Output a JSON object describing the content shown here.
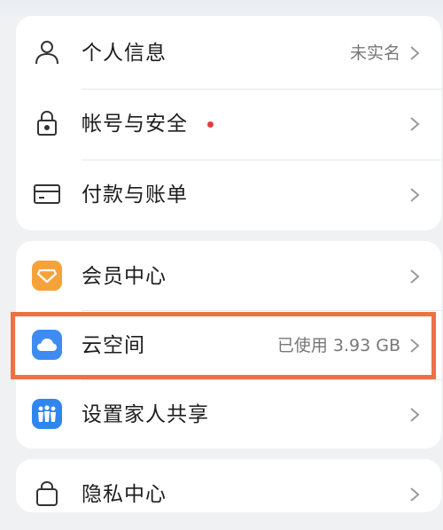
{
  "card_account": {
    "items": [
      {
        "label": "个人信息",
        "value": "未实名",
        "icon": "person-icon"
      },
      {
        "label": "帐号与安全",
        "value": "",
        "icon": "lock-icon",
        "badge": "red-dot"
      },
      {
        "label": "付款与账单",
        "value": "",
        "icon": "card-icon"
      }
    ]
  },
  "card_services": {
    "items": [
      {
        "label": "会员中心",
        "value": "",
        "icon": "diamond-icon",
        "icon_color": "#f6a23a"
      },
      {
        "label": "云空间",
        "value": "已使用 3.93 GB",
        "icon": "cloud-icon",
        "icon_color": "#3e8cf2"
      },
      {
        "label": "设置家人共享",
        "value": "",
        "icon": "family-share-icon",
        "icon_color": "#2f86ef"
      }
    ]
  },
  "card_privacy": {
    "items": [
      {
        "label": "隐私中心",
        "value": "",
        "icon": "privacy-icon"
      }
    ]
  },
  "colors": {
    "highlight": "#ec7145",
    "badge": "#e53c3c",
    "page_background": "#eff1f3"
  }
}
